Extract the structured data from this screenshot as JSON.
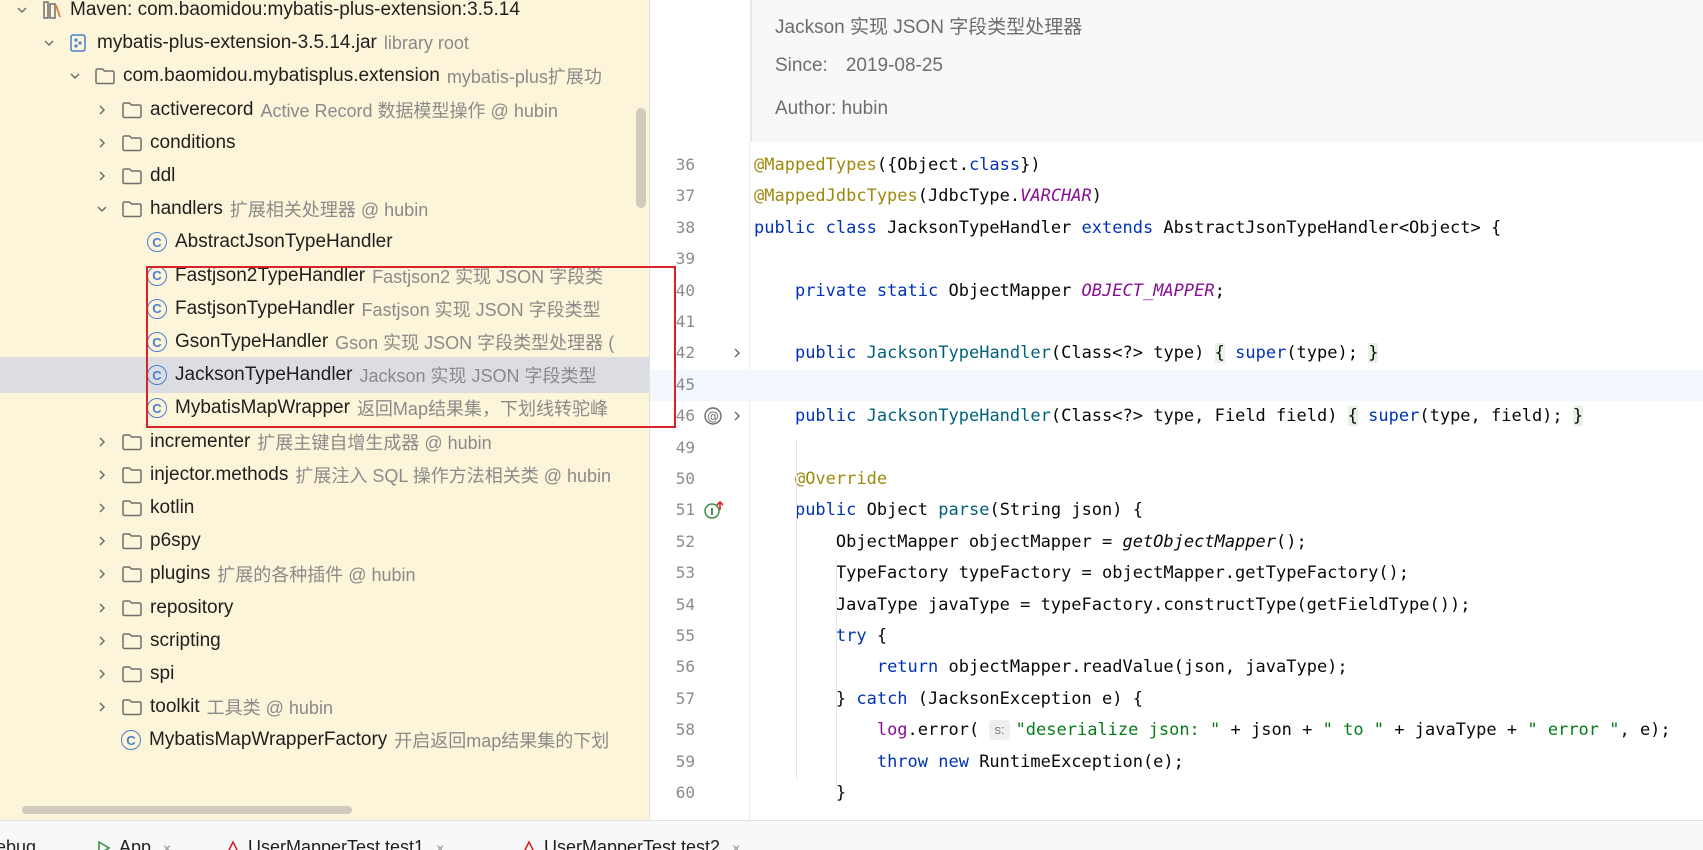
{
  "tree": {
    "rows": [
      {
        "name": "Maven: com.baomidou:mybatis-plus-extension:3.5.14",
        "hint": "",
        "icon": "library-icon",
        "indent": 1,
        "expanded": true
      },
      {
        "name": "mybatis-plus-extension-3.5.14.jar",
        "hint": "library root",
        "icon": "jar-icon",
        "indent": 2,
        "expanded": true
      },
      {
        "name": "com.baomidou.mybatisplus.extension",
        "hint": "mybatis-plus扩展功",
        "icon": "folder-icon",
        "indent": 3,
        "expanded": true
      },
      {
        "name": "activerecord",
        "hint": "Active Record 数据模型操作 @ hubin",
        "icon": "folder-icon",
        "indent": 4,
        "expanded": false
      },
      {
        "name": "conditions",
        "hint": "",
        "icon": "folder-icon",
        "indent": 4,
        "expanded": false
      },
      {
        "name": "ddl",
        "hint": "",
        "icon": "folder-icon",
        "indent": 4,
        "expanded": false
      },
      {
        "name": "handlers",
        "hint": "扩展相关处理器 @ hubin",
        "icon": "folder-icon",
        "indent": 4,
        "expanded": true
      },
      {
        "name": "AbstractJsonTypeHandler",
        "hint": "",
        "icon": "class-icon",
        "indent": 5,
        "expanded": null
      },
      {
        "name": "Fastjson2TypeHandler",
        "hint": "Fastjson2 实现 JSON 字段类",
        "icon": "class-icon",
        "indent": 5,
        "expanded": null
      },
      {
        "name": "FastjsonTypeHandler",
        "hint": "Fastjson 实现 JSON 字段类型",
        "icon": "class-icon",
        "indent": 5,
        "expanded": null
      },
      {
        "name": "GsonTypeHandler",
        "hint": "Gson 实现 JSON 字段类型处理器 (",
        "icon": "class-icon",
        "indent": 5,
        "expanded": null
      },
      {
        "name": "JacksonTypeHandler",
        "hint": "Jackson 实现 JSON 字段类型",
        "icon": "class-icon",
        "indent": 5,
        "expanded": null,
        "selected": true
      },
      {
        "name": "MybatisMapWrapper",
        "hint": "返回Map结果集，下划线转驼峰",
        "icon": "class-icon",
        "indent": 5,
        "expanded": null
      },
      {
        "name": "incrementer",
        "hint": "扩展主键自增生成器 @ hubin",
        "icon": "folder-icon",
        "indent": 4,
        "expanded": false
      },
      {
        "name": "injector.methods",
        "hint": "扩展注入 SQL 操作方法相关类 @ hubin",
        "icon": "folder-icon",
        "indent": 4,
        "expanded": false
      },
      {
        "name": "kotlin",
        "hint": "",
        "icon": "folder-icon",
        "indent": 4,
        "expanded": false
      },
      {
        "name": "p6spy",
        "hint": "",
        "icon": "folder-icon",
        "indent": 4,
        "expanded": false
      },
      {
        "name": "plugins",
        "hint": "扩展的各种插件 @ hubin",
        "icon": "folder-icon",
        "indent": 4,
        "expanded": false
      },
      {
        "name": "repository",
        "hint": "",
        "icon": "folder-icon",
        "indent": 4,
        "expanded": false
      },
      {
        "name": "scripting",
        "hint": "",
        "icon": "folder-icon",
        "indent": 4,
        "expanded": false
      },
      {
        "name": "spi",
        "hint": "",
        "icon": "folder-icon",
        "indent": 4,
        "expanded": false
      },
      {
        "name": "toolkit",
        "hint": "工具类 @ hubin",
        "icon": "folder-icon",
        "indent": 4,
        "expanded": false
      },
      {
        "name": "MybatisMapWrapperFactory",
        "hint": "开启返回map结果集的下划",
        "icon": "class-icon",
        "indent": 4,
        "expanded": null
      }
    ]
  },
  "editor": {
    "doc": {
      "description": "Jackson 实现 JSON 字段类型处理器",
      "since_label": "Since:",
      "since_value": "2019-08-25",
      "author_label": "Author:",
      "author_value": "hubin"
    },
    "lines": [
      {
        "num": "36",
        "gutter": "",
        "html": "<span class=\"ann\">@MappedTypes</span>({Object.<span class=\"kw\">class</span>})"
      },
      {
        "num": "37",
        "gutter": "",
        "html": "<span class=\"ann\">@MappedJdbcTypes</span>(JdbcType.<span class=\"fld\">VARCHAR</span>)"
      },
      {
        "num": "38",
        "gutter": "",
        "html": "<span class=\"kw\">public class</span> JacksonTypeHandler <span class=\"kw\">extends</span> AbstractJsonTypeHandler&lt;Object&gt; {"
      },
      {
        "num": "39",
        "gutter": "",
        "html": ""
      },
      {
        "num": "40",
        "gutter": "",
        "html": "    <span class=\"kw\">private static</span> ObjectMapper <span class=\"fld\">OBJECT_MAPPER</span>;"
      },
      {
        "num": "41",
        "gutter": "",
        "html": ""
      },
      {
        "num": "42",
        "gutter": "fold",
        "html": "    <span class=\"kw\">public</span> <span class=\"mth\">JacksonTypeHandler</span>(Class&lt;?&gt; type) <span class=\"brace\">{</span> <span class=\"kw\">super</span>(type); <span class=\"brace\">}</span>"
      },
      {
        "num": "45",
        "gutter": "",
        "html": "",
        "current": true
      },
      {
        "num": "46",
        "gutter": "at-fold",
        "html": "    <span class=\"kw\">public</span> <span class=\"mth\">JacksonTypeHandler</span>(Class&lt;?&gt; type, Field field) <span class=\"brace\">{</span> <span class=\"kw\">super</span>(type, field); <span class=\"brace\">}</span>"
      },
      {
        "num": "49",
        "gutter": "",
        "html": ""
      },
      {
        "num": "50",
        "gutter": "",
        "html": "    <span class=\"ann\">@Override</span>"
      },
      {
        "num": "51",
        "gutter": "override",
        "html": "    <span class=\"kw\">public</span> Object <span class=\"mth\">parse</span>(String json) {"
      },
      {
        "num": "52",
        "gutter": "",
        "html": "        ObjectMapper objectMapper = <span class=\"itm\">getObjectMapper</span>();"
      },
      {
        "num": "53",
        "gutter": "",
        "html": "        TypeFactory typeFactory = objectMapper.getTypeFactory();"
      },
      {
        "num": "54",
        "gutter": "",
        "html": "        JavaType javaType = typeFactory.constructType(getFieldType());"
      },
      {
        "num": "55",
        "gutter": "",
        "html": "        <span class=\"kw\">try</span> {"
      },
      {
        "num": "56",
        "gutter": "",
        "html": "            <span class=\"kw\">return</span> objectMapper.readValue(json, javaType);"
      },
      {
        "num": "57",
        "gutter": "",
        "html": "        } <span class=\"kw\">catch</span> (JacksonException e) {"
      },
      {
        "num": "58",
        "gutter": "",
        "html": "            <span class=\"lg\">log</span>.error( <span class=\"hintbox\">s:</span><span class=\"str\">\"deserialize json: \"</span> + json + <span class=\"str\">\" to \"</span> + javaType + <span class=\"str\">\" error \"</span>, e);"
      },
      {
        "num": "59",
        "gutter": "",
        "html": "            <span class=\"kw\">throw new</span> RuntimeException(e);"
      },
      {
        "num": "60",
        "gutter": "",
        "html": "        }"
      }
    ]
  },
  "bottom_tabs": [
    {
      "label": "ebug",
      "icon": ""
    },
    {
      "label": "App",
      "icon": "run-icon"
    },
    {
      "label": "UserMapperTest.test1",
      "icon": "test-icon"
    },
    {
      "label": "UserMapperTest.test2",
      "icon": "test-icon"
    }
  ]
}
